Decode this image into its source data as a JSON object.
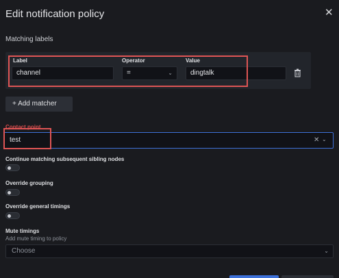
{
  "dialog": {
    "title": "Edit notification policy",
    "close_icon": "close-icon"
  },
  "matching": {
    "section_label": "Matching labels",
    "columns": {
      "label": "Label",
      "operator": "Operator",
      "value": "Value"
    },
    "row": {
      "label": "channel",
      "operator": "=",
      "value": "dingtalk",
      "delete_icon": "trash-icon"
    },
    "add_button": "+ Add matcher"
  },
  "contact_point": {
    "label": "Contact point",
    "value": "test",
    "clear_icon": "close-icon",
    "chevron_icon": "chevron-down-icon"
  },
  "options": {
    "continue_matching": {
      "label": "Continue matching subsequent sibling nodes",
      "enabled": false
    },
    "override_grouping": {
      "label": "Override grouping",
      "enabled": false
    },
    "override_timings": {
      "label": "Override general timings",
      "enabled": false
    }
  },
  "mute_timings": {
    "label": "Mute timings",
    "description": "Add mute timing to policy",
    "placeholder": "Choose"
  },
  "colors": {
    "background": "#1a1b1f",
    "highlight": "#e05555",
    "focus_border": "#3d71d9",
    "primary_button": "#3d71d9"
  }
}
